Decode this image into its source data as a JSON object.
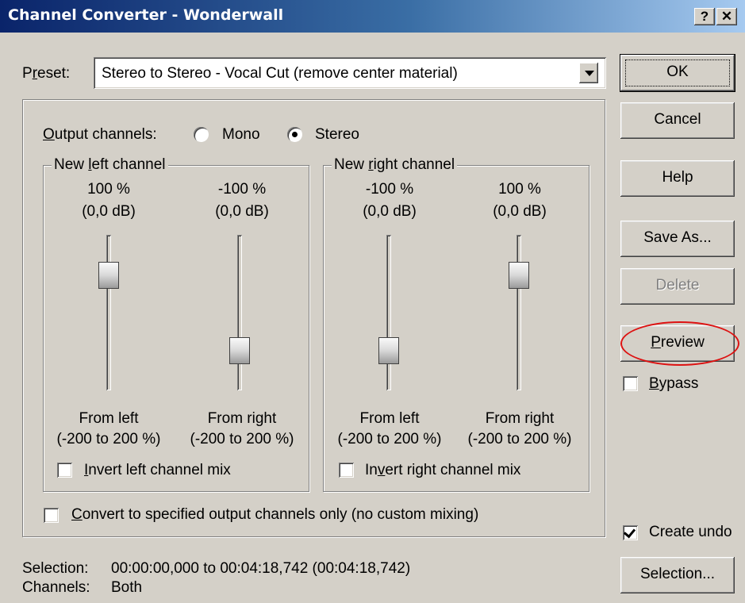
{
  "window": {
    "title": "Channel Converter - Wonderwall",
    "help_glyph": "?",
    "close_glyph": "✕"
  },
  "preset": {
    "label_prefix": "P",
    "label_underlined": "r",
    "label_suffix": "eset:",
    "value": "Stereo to Stereo - Vocal Cut (remove center material)"
  },
  "output_channels": {
    "label_underlined": "O",
    "label_suffix": "utput channels:",
    "mono_label": "Mono",
    "stereo_label": "Stereo",
    "selected": "Stereo"
  },
  "left_group": {
    "title_prefix": "New ",
    "title_underlined": "l",
    "title_suffix": "eft channel",
    "slider1": {
      "percent": "100 %",
      "db": "(0,0 dB)",
      "from": "From left",
      "range": "(-200 to 200 %)"
    },
    "slider2": {
      "percent": "-100 %",
      "db": "(0,0 dB)",
      "from": "From right",
      "range": "(-200 to 200 %)"
    },
    "invert_underlined": "I",
    "invert_suffix": "nvert left channel mix",
    "invert_checked": false
  },
  "right_group": {
    "title_prefix": "New ",
    "title_underlined": "r",
    "title_suffix": "ight channel",
    "slider1": {
      "percent": "-100 %",
      "db": "(0,0 dB)",
      "from": "From left",
      "range": "(-200 to 200 %)"
    },
    "slider2": {
      "percent": "100 %",
      "db": "(0,0 dB)",
      "from": "From right",
      "range": "(-200 to 200 %)"
    },
    "invert_prefix": "In",
    "invert_underlined": "v",
    "invert_suffix": "ert right channel mix",
    "invert_checked": false
  },
  "convert_only": {
    "underlined": "C",
    "suffix": "onvert to specified output channels only (no custom mixing)",
    "checked": false
  },
  "buttons": {
    "ok": "OK",
    "cancel": "Cancel",
    "help": "Help",
    "save_as": "Save As...",
    "delete": "Delete",
    "preview_underlined": "P",
    "preview_suffix": "review",
    "selection": "Selection..."
  },
  "bypass": {
    "underlined": "B",
    "suffix": "ypass",
    "checked": false
  },
  "create_undo": {
    "label": "Create undo",
    "checked": true
  },
  "status": {
    "selection_label": "Selection:",
    "selection_value": "00:00:00,000 to 00:04:18,742 (00:04:18,742)",
    "channels_label": "Channels:",
    "channels_value": "Both"
  }
}
